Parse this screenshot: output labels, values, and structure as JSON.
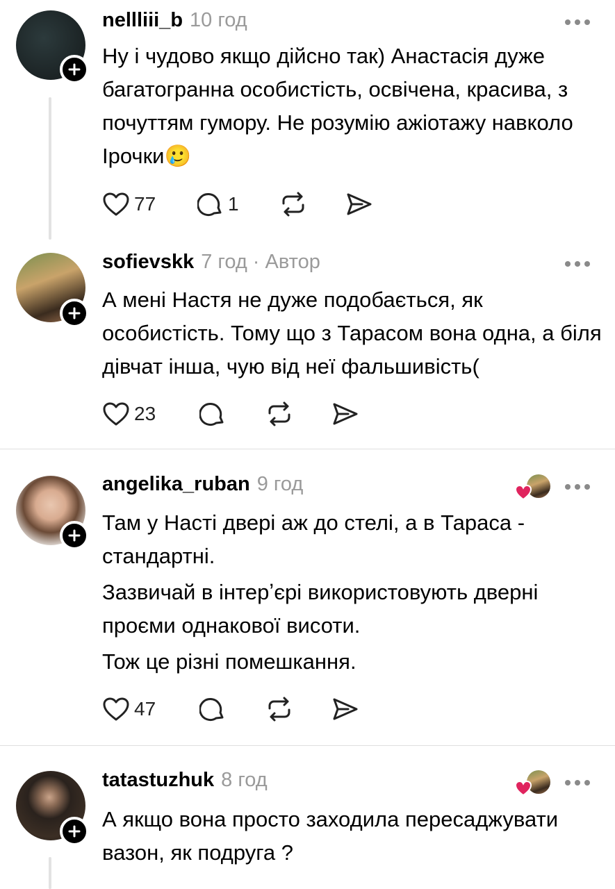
{
  "comments": [
    {
      "username": "nellliii_b",
      "meta": "10 год",
      "lines": [
        "Ну і чудово якщо дійсно так) Анастасія дуже багатогранна особистість, освічена, красива, з почуттям гумору. Не розумію ажіотажу навколо Ірочки"
      ],
      "emoji": "🥲",
      "likes": "77",
      "replies": "1"
    },
    {
      "username": "sofievskk",
      "meta": "7 год · Автор",
      "lines": [
        "А мені Настя не дуже подобається, як особистість. Тому що з Тарасом вона одна, а біля дівчат інша, чую від неї фальшивість("
      ],
      "likes": "23",
      "replies": ""
    },
    {
      "username": "angelika_ruban",
      "meta": "9 год",
      "lines": [
        "Там у Насті двері аж до стелі, а в Тараса - стандартні.",
        "Зазвичай в інтерʼєрі використовують дверні проєми однакової висоти.",
        "Тож це різні помешкання."
      ],
      "likes": "47",
      "replies": ""
    },
    {
      "username": "tatastuzhuk",
      "meta": "8 год",
      "lines": [
        "А якщо вона просто заходила пересаджувати вазон, як подруга ?"
      ]
    }
  ],
  "icons": {
    "like": "heart-outline-icon",
    "reply": "speech-bubble-icon",
    "repost": "repost-arrows-icon",
    "share": "paper-plane-icon",
    "more": "ellipsis-icon",
    "follow": "plus-icon",
    "liked_by_author": "heart-filled-icon"
  },
  "colors": {
    "meta": "#9a9a9a",
    "heart": "#e0245e",
    "divider": "#dedede"
  }
}
